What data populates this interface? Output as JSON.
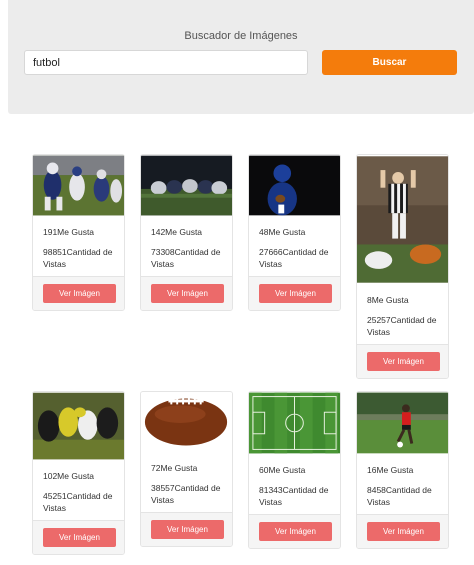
{
  "search": {
    "title": "Buscador de Imágenes",
    "value": "futbol",
    "button_label": "Buscar",
    "accent": "#f47c0c"
  },
  "results": [
    {
      "likes": "191Me Gusta",
      "views": "98851Cantidad de Vistas",
      "button": "Ver Imágen",
      "image": "american-football-quarterback-photo"
    },
    {
      "likes": "142Me Gusta",
      "views": "73308Cantidad de Vistas",
      "button": "Ver Imágen",
      "image": "football-line-of-scrimmage-night-photo"
    },
    {
      "likes": "48Me Gusta",
      "views": "27666Cantidad de Vistas",
      "button": "Ver Imágen",
      "image": "football-player-holding-ball-photo"
    },
    {
      "likes": "8Me Gusta",
      "views": "25257Cantidad de Vistas",
      "button": "Ver Imágen",
      "image": "referee-signaling-touchdown-photo"
    },
    {
      "likes": "102Me Gusta",
      "views": "45251Cantidad de Vistas",
      "button": "Ver Imágen",
      "image": "football-tackle-blurred-photo"
    },
    {
      "likes": "72Me Gusta",
      "views": "38557Cantidad de Vistas",
      "button": "Ver Imágen",
      "image": "american-football-ball-photo"
    },
    {
      "likes": "60Me Gusta",
      "views": "81343Cantidad de Vistas",
      "button": "Ver Imágen",
      "image": "soccer-field-aerial-photo"
    },
    {
      "likes": "16Me Gusta",
      "views": "8458Cantidad de Vistas",
      "button": "Ver Imágen",
      "image": "soccer-player-kicking-ball-photo"
    }
  ],
  "colors": {
    "view_button": "#ec6a6a",
    "panel": "#ececec"
  }
}
